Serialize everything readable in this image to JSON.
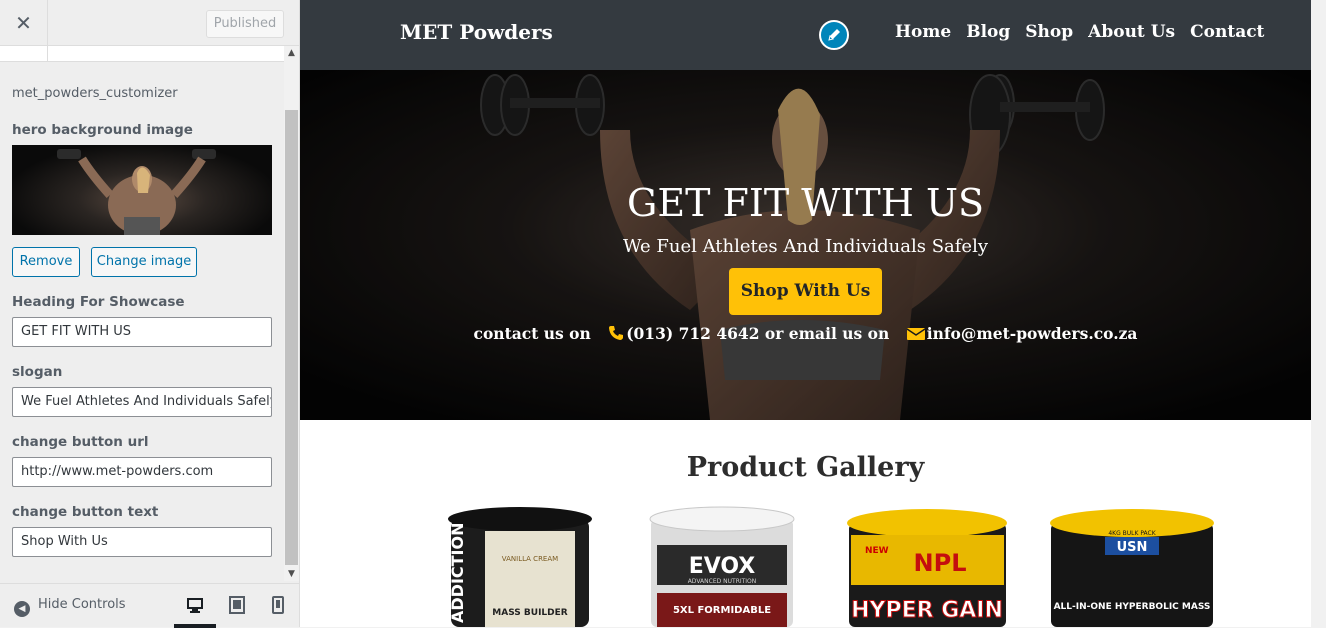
{
  "customizer": {
    "close_icon": "close-icon",
    "published_label": "Published",
    "section_id": "met_powders_customizer",
    "controls": {
      "hero_bg_label": "hero background image",
      "remove_label": "Remove",
      "change_image_label": "Change image",
      "heading_label": "Heading For Showcase",
      "heading_value": "GET FIT WITH US",
      "slogan_label": "slogan",
      "slogan_value": "We Fuel Athletes And Individuals Safely",
      "button_url_label": "change button url",
      "button_url_value": "http://www.met-powders.com",
      "button_text_label": "change button text",
      "button_text_value": "Shop With Us"
    },
    "footer": {
      "hide_controls_label": "Hide Controls",
      "devices": [
        "desktop-icon",
        "tablet-icon",
        "mobile-icon"
      ],
      "active_device": "desktop"
    }
  },
  "site": {
    "brand": "MET Powders",
    "nav": [
      "Home",
      "Blog",
      "Shop",
      "About Us",
      "Contact"
    ],
    "hero": {
      "title": "GET FIT WITH US",
      "slogan": "We Fuel Athletes And Individuals Safely",
      "button_label": "Shop With Us",
      "contact_prefix": "contact us on",
      "phone": "(013) 712 4642 or email us on",
      "email": "info@met-powders.co.za"
    },
    "gallery": {
      "title": "Product Gallery",
      "products": [
        {
          "name": "ADDICTION",
          "sub": "MASS BUILDER",
          "flavour": "VANILLA CREAM",
          "lid": "#1a1a1a"
        },
        {
          "name": "EVOX",
          "sub": "5XL FORMIDABLE",
          "flavour": "ADVANCED NUTRITION",
          "lid": "#e8e8e8"
        },
        {
          "name": "NPL",
          "sub": "HYPER GAIN",
          "flavour": "NEW",
          "lid": "#f2c200"
        },
        {
          "name": "USN",
          "sub": "ALL-IN-ONE HYPERBOLIC MASS",
          "flavour": "4KG BULK PACK",
          "lid": "#f2c200"
        }
      ]
    }
  },
  "colors": {
    "accent_blue": "#0073aa",
    "nav_bg": "#343a40",
    "button_yellow": "#ffc107"
  }
}
